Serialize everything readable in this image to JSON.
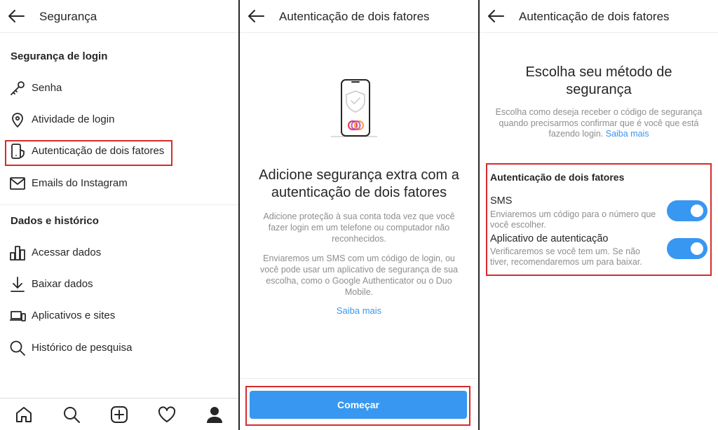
{
  "security": {
    "title": "Segurança",
    "login_section": "Segurança de login",
    "items": [
      {
        "label": "Senha",
        "icon": "key-icon"
      },
      {
        "label": "Atividade de login",
        "icon": "location-pin-icon"
      },
      {
        "label": "Autenticação de dois fatores",
        "icon": "phone-shield-icon"
      },
      {
        "label": "Emails do Instagram",
        "icon": "mail-icon"
      }
    ],
    "data_section": "Dados e histórico",
    "data_items": [
      {
        "label": "Acessar dados",
        "icon": "bar-chart-icon"
      },
      {
        "label": "Baixar dados",
        "icon": "download-icon"
      },
      {
        "label": "Aplicativos e sites",
        "icon": "devices-icon"
      },
      {
        "label": "Histórico de pesquisa",
        "icon": "search-icon"
      }
    ],
    "nav": [
      "home-icon",
      "search-icon",
      "add-post-icon",
      "heart-icon",
      "profile-icon"
    ],
    "highlight_color": "#d72b2b"
  },
  "intro": {
    "title": "Autenticação de dois fatores",
    "headline": "Adicione segurança extra com a autenticação de dois fatores",
    "desc1": "Adicione proteção à sua conta toda vez que você fazer login em um telefone ou computador não reconhecidos.",
    "desc2": "Enviaremos um SMS com um código de login, ou você pode usar um aplicativo de segurança de sua escolha, como o Google Authenticator ou o Duo Mobile.",
    "learn_more": "Saiba mais",
    "button": "Começar",
    "accent": "#3897f0"
  },
  "method": {
    "title": "Autenticação de dois fatores",
    "headline": "Escolha seu método de segurança",
    "desc": "Escolha como deseja receber o código de segurança quando precisarmos confirmar que é você que está fazendo login.",
    "learn_more": "Saiba mais",
    "section": "Autenticação de dois fatores",
    "options": [
      {
        "label": "SMS",
        "desc": "Enviaremos um código para o número que você escolher.",
        "enabled": true
      },
      {
        "label": "Aplicativo de autenticação",
        "desc": "Verificaremos se você tem um. Se não tiver, recomendaremos um para baixar.",
        "enabled": true
      }
    ]
  }
}
